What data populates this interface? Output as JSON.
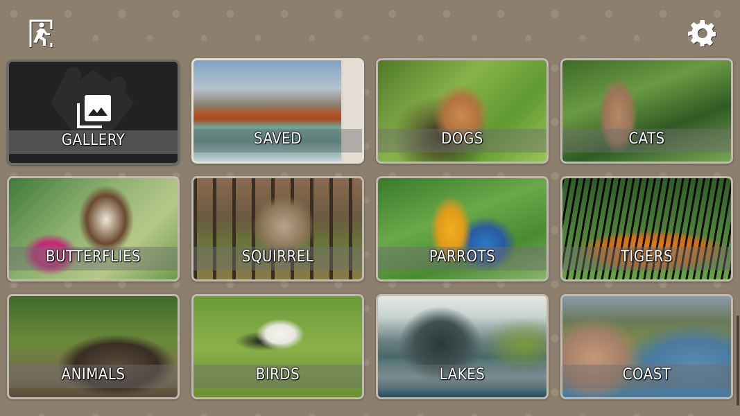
{
  "topbar": {
    "exit_icon": "exit-door-icon",
    "settings_icon": "gear-icon"
  },
  "categories": [
    {
      "label": "GALLERY",
      "kind": "gallery",
      "icon": "photo-library-icon"
    },
    {
      "label": "SAVED",
      "kind": "saved"
    },
    {
      "label": "DOGS",
      "kind": "photo"
    },
    {
      "label": "CATS",
      "kind": "photo"
    },
    {
      "label": "BUTTERFLIES",
      "kind": "photo"
    },
    {
      "label": "SQUIRREL",
      "kind": "photo"
    },
    {
      "label": "PARROTS",
      "kind": "photo"
    },
    {
      "label": "TIGERS",
      "kind": "photo"
    },
    {
      "label": "ANIMALS",
      "kind": "photo"
    },
    {
      "label": "BIRDS",
      "kind": "photo"
    },
    {
      "label": "LAKES",
      "kind": "photo"
    },
    {
      "label": "COAST",
      "kind": "photo"
    }
  ],
  "colors": {
    "background": "#8c7f6e",
    "gallery_tile": "#222222",
    "label_text": "#ffffff"
  }
}
